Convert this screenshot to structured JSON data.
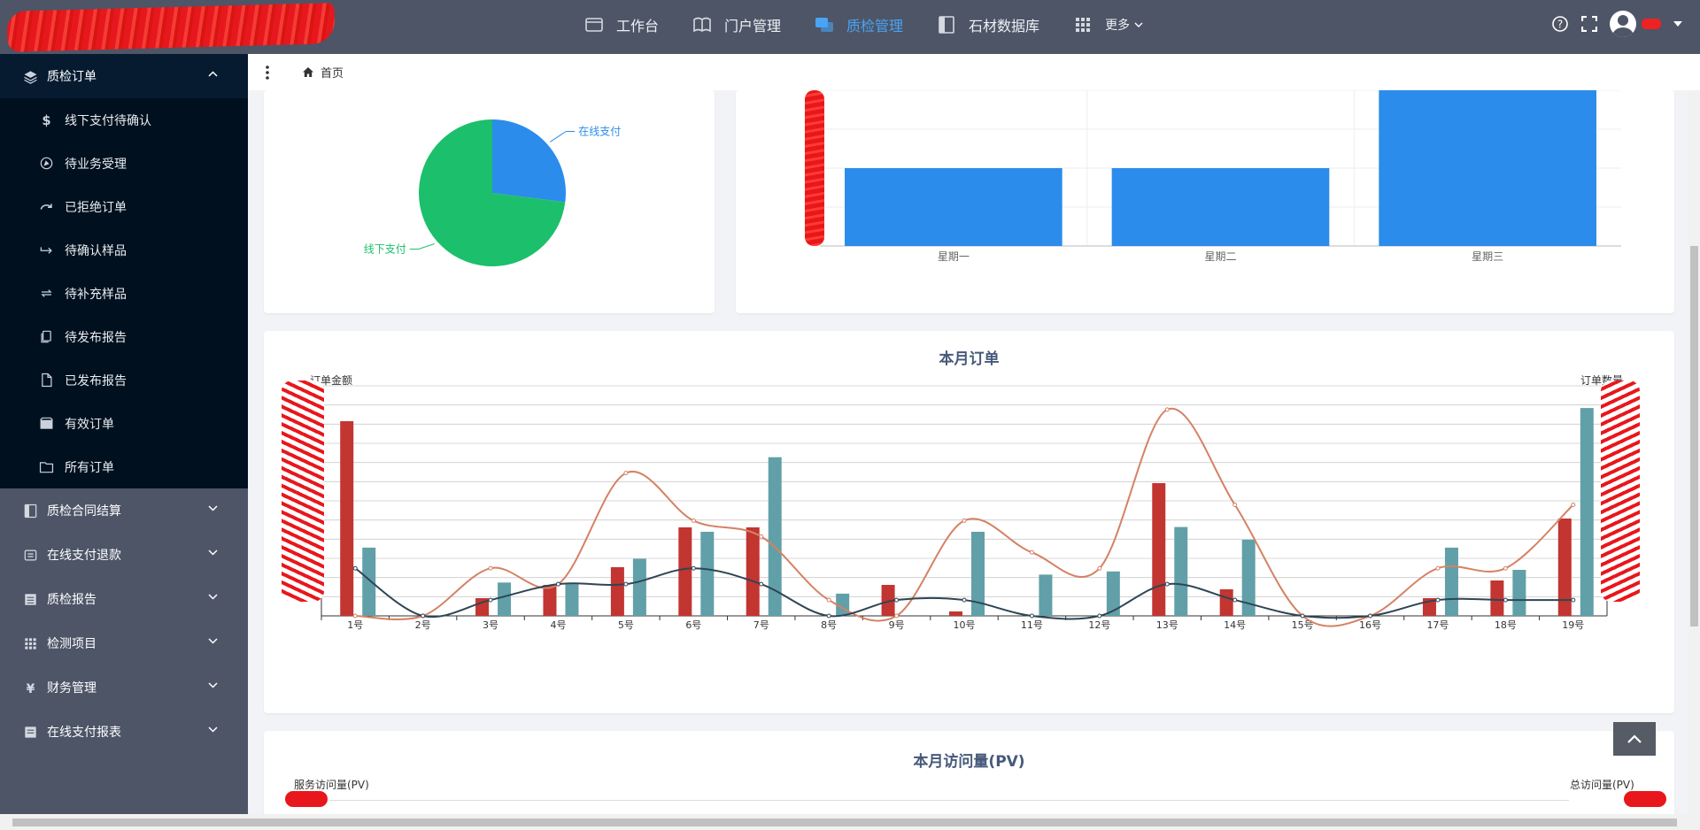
{
  "topbar": {
    "nav": [
      {
        "label": "工作台",
        "icon": "workbench-icon",
        "active": false
      },
      {
        "label": "门户管理",
        "icon": "book-open-icon",
        "active": false
      },
      {
        "label": "质检管理",
        "icon": "chat-bubbles-icon",
        "active": true
      },
      {
        "label": "石材数据库",
        "icon": "book-icon",
        "active": false
      },
      {
        "label": "更多",
        "icon": "grid-icon",
        "active": false
      }
    ]
  },
  "sidebar": {
    "open_group": {
      "label": "质检订单",
      "icon": "layers-icon"
    },
    "children": [
      {
        "label": "线下支付待确认",
        "icon": "dollar-icon"
      },
      {
        "label": "待业务受理",
        "icon": "compass-icon"
      },
      {
        "label": "已拒绝订单",
        "icon": "redo-icon"
      },
      {
        "label": "待确认样品",
        "icon": "arrow-right-icon"
      },
      {
        "label": "待补充样品",
        "icon": "swap-icon"
      },
      {
        "label": "待发布报告",
        "icon": "copy-icon"
      },
      {
        "label": "已发布报告",
        "icon": "file-icon"
      },
      {
        "label": "有效订单",
        "icon": "box-icon"
      },
      {
        "label": "所有订单",
        "icon": "folder-icon"
      }
    ],
    "groups": [
      {
        "label": "质检合同结算",
        "icon": "book-icon"
      },
      {
        "label": "在线支付退款",
        "icon": "wallet-icon"
      },
      {
        "label": "质检报告",
        "icon": "list-icon"
      },
      {
        "label": "检测项目",
        "icon": "grid-icon"
      },
      {
        "label": "财务管理",
        "icon": "yen-icon"
      },
      {
        "label": "在线支付报表",
        "icon": "report-icon"
      }
    ]
  },
  "breadcrumb": {
    "home": "首页"
  },
  "colors": {
    "blue": "#2b8ceb",
    "green": "#1cbf6b",
    "red": "#c23531",
    "teal": "#61a0a8",
    "orange": "#d48265",
    "navy": "#2f4554",
    "accent": "#4aa3f5"
  },
  "chart_data": [
    {
      "type": "pie",
      "slices": [
        {
          "name": "在线支付",
          "value": 27,
          "color": "#2b8ceb"
        },
        {
          "name": "线下支付",
          "value": 73,
          "color": "#1cbf6b"
        }
      ]
    },
    {
      "type": "bar",
      "categories": [
        "星期一",
        "星期二",
        "星期三"
      ],
      "values": [
        2,
        2,
        4
      ],
      "ylim": [
        0,
        4
      ],
      "color": "#2b8ceb"
    },
    {
      "type": "bar+line",
      "title": "本月订单",
      "ylabel_left": "订单金额",
      "ylabel_right": "订单数量",
      "categories": [
        "1号",
        "2号",
        "3号",
        "4号",
        "5号",
        "6号",
        "7号",
        "8号",
        "9号",
        "10号",
        "11号",
        "12号",
        "13号",
        "14号",
        "15号",
        "16号",
        "17号",
        "18号",
        "19号"
      ],
      "series": [
        {
          "type": "bar",
          "axis": "left",
          "color": "#c23531",
          "values": [
            22,
            0,
            2,
            3.5,
            5.5,
            10,
            10,
            0,
            3.5,
            0.5,
            0,
            0,
            15,
            3,
            0,
            0,
            2,
            4,
            11
          ]
        },
        {
          "type": "bar",
          "axis": "right",
          "color": "#61a0a8",
          "values": [
            4.3,
            0,
            2.1,
            2.0,
            3.6,
            5.3,
            10.0,
            1.4,
            0,
            5.3,
            2.6,
            2.8,
            5.6,
            4.8,
            0,
            0,
            4.3,
            2.9,
            13.1
          ]
        },
        {
          "type": "line",
          "axis": "right",
          "color": "#d48265",
          "values": [
            0,
            0,
            3,
            2,
            9,
            6,
            5,
            1,
            0,
            6,
            4,
            3,
            13,
            7,
            0,
            0,
            3,
            3,
            7
          ]
        },
        {
          "type": "line",
          "axis": "right",
          "color": "#2f4554",
          "values": [
            3,
            0,
            1,
            2,
            2,
            3,
            2,
            0,
            1,
            1,
            0,
            0,
            2,
            1,
            0,
            0,
            1,
            1,
            1
          ]
        }
      ]
    },
    {
      "type": "line",
      "title": "本月访问量(PV)",
      "ylabel_left": "服务访问量(PV)",
      "ylabel_right": "总访问量(PV)"
    }
  ]
}
